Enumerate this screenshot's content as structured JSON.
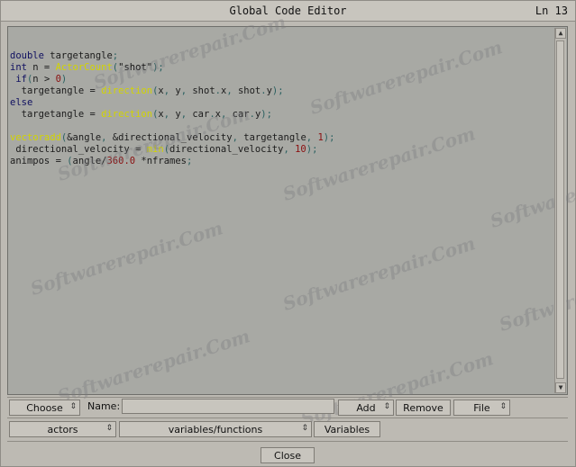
{
  "window": {
    "title": "Global Code Editor",
    "line_indicator": "Ln 13"
  },
  "code_lines": [
    [
      {
        "t": "kw",
        "s": "double"
      },
      {
        "t": "plain",
        "s": " targetangle"
      },
      {
        "t": "op",
        "s": ";"
      }
    ],
    [
      {
        "t": "kw",
        "s": "int"
      },
      {
        "t": "plain",
        "s": " n = "
      },
      {
        "t": "fn",
        "s": "ActorCount"
      },
      {
        "t": "op",
        "s": "("
      },
      {
        "t": "str",
        "s": "\"shot\""
      },
      {
        "t": "op",
        "s": ");"
      }
    ],
    [
      {
        "t": "kw",
        "s": " if"
      },
      {
        "t": "op",
        "s": "("
      },
      {
        "t": "plain",
        "s": "n > "
      },
      {
        "t": "num",
        "s": "0"
      },
      {
        "t": "op",
        "s": ")"
      }
    ],
    [
      {
        "t": "plain",
        "s": "  targetangle = "
      },
      {
        "t": "fn",
        "s": "direction"
      },
      {
        "t": "op",
        "s": "("
      },
      {
        "t": "plain",
        "s": "x"
      },
      {
        "t": "op",
        "s": ", "
      },
      {
        "t": "plain",
        "s": "y"
      },
      {
        "t": "op",
        "s": ", "
      },
      {
        "t": "plain",
        "s": "shot"
      },
      {
        "t": "op",
        "s": "."
      },
      {
        "t": "plain",
        "s": "x"
      },
      {
        "t": "op",
        "s": ", "
      },
      {
        "t": "plain",
        "s": "shot"
      },
      {
        "t": "op",
        "s": "."
      },
      {
        "t": "plain",
        "s": "y"
      },
      {
        "t": "op",
        "s": ");"
      }
    ],
    [
      {
        "t": "kw",
        "s": "else"
      }
    ],
    [
      {
        "t": "plain",
        "s": "  targetangle = "
      },
      {
        "t": "fn",
        "s": "direction"
      },
      {
        "t": "op",
        "s": "("
      },
      {
        "t": "plain",
        "s": "x"
      },
      {
        "t": "op",
        "s": ", "
      },
      {
        "t": "plain",
        "s": "y"
      },
      {
        "t": "op",
        "s": ", "
      },
      {
        "t": "plain",
        "s": "car"
      },
      {
        "t": "op",
        "s": "."
      },
      {
        "t": "plain",
        "s": "x"
      },
      {
        "t": "op",
        "s": ", "
      },
      {
        "t": "plain",
        "s": "car"
      },
      {
        "t": "op",
        "s": "."
      },
      {
        "t": "plain",
        "s": "y"
      },
      {
        "t": "op",
        "s": ");"
      }
    ],
    [
      {
        "t": "plain",
        "s": ""
      }
    ],
    [
      {
        "t": "fn",
        "s": "vectoradd"
      },
      {
        "t": "op",
        "s": "("
      },
      {
        "t": "plain",
        "s": "&angle"
      },
      {
        "t": "op",
        "s": ", "
      },
      {
        "t": "plain",
        "s": "&directional_velocity"
      },
      {
        "t": "op",
        "s": ", "
      },
      {
        "t": "plain",
        "s": "targetangle"
      },
      {
        "t": "op",
        "s": ", "
      },
      {
        "t": "num",
        "s": "1"
      },
      {
        "t": "op",
        "s": ");"
      }
    ],
    [
      {
        "t": "plain",
        "s": " directional_velocity = "
      },
      {
        "t": "fn",
        "s": "min"
      },
      {
        "t": "op",
        "s": "("
      },
      {
        "t": "plain",
        "s": "directional_velocity"
      },
      {
        "t": "op",
        "s": ", "
      },
      {
        "t": "num",
        "s": "10"
      },
      {
        "t": "op",
        "s": ");"
      }
    ],
    [
      {
        "t": "plain",
        "s": "animpos = "
      },
      {
        "t": "op",
        "s": "("
      },
      {
        "t": "plain",
        "s": "angle/"
      },
      {
        "t": "num",
        "s": "360.0"
      },
      {
        "t": "plain",
        "s": " *nframes"
      },
      {
        "t": "op",
        "s": ";"
      }
    ]
  ],
  "watermark": "Softwarerepair.Com",
  "toolbar": {
    "choose_label": "Choose",
    "name_label": "Name:",
    "name_value": "",
    "add_label": "Add",
    "remove_label": "Remove",
    "file_label": "File",
    "actors_label": "actors",
    "varfunc_label": "variables/functions",
    "variables_label": "Variables",
    "close_label": "Close"
  },
  "colors": {
    "window_bg": "#bdbab3",
    "editor_bg": "#a8a9a4",
    "keyword": "#101060",
    "function": "#d2d400",
    "number": "#8a1010"
  }
}
